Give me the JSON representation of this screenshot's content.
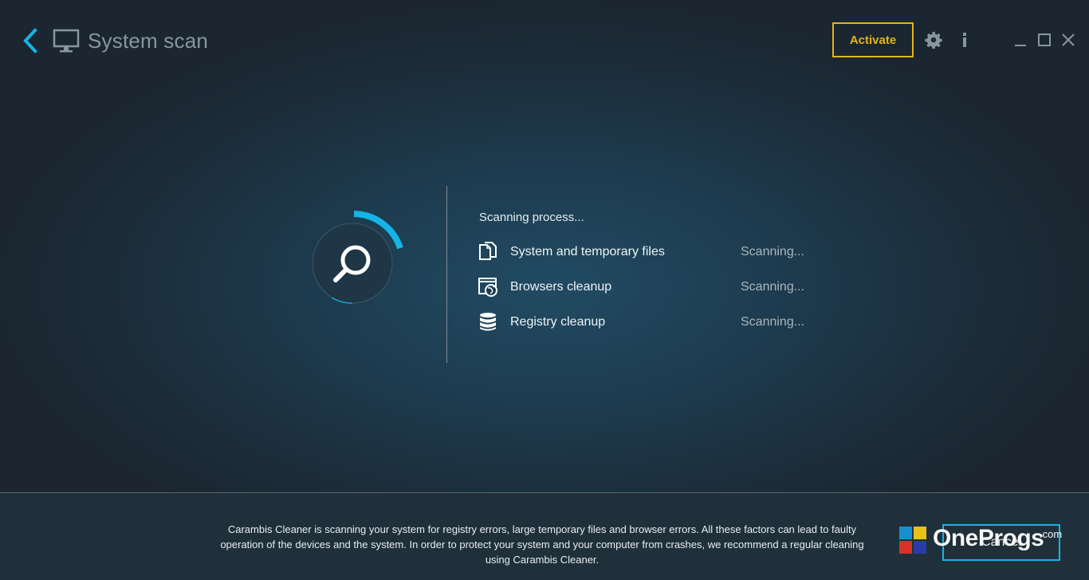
{
  "header": {
    "title": "System scan",
    "activate_label": "Activate",
    "accent_color": "#16b4e6",
    "activate_color": "#e2b41e"
  },
  "scan": {
    "heading": "Scanning process...",
    "items": [
      {
        "label": "System and temporary files",
        "status": "Scanning...",
        "icon": "files-icon"
      },
      {
        "label": "Browsers cleanup",
        "status": "Scanning...",
        "icon": "browser-globe-icon"
      },
      {
        "label": "Registry cleanup",
        "status": "Scanning...",
        "icon": "database-icon"
      }
    ]
  },
  "footer": {
    "description": "Carambis Cleaner is scanning your system for registry errors, large temporary files and browser errors. All these factors can lead to faulty operation of the devices and the system. In order to protect your system and your computer from crashes, we recommend a regular cleaning using Carambis Cleaner.",
    "cancel_label": "Cancel"
  },
  "watermark": {
    "text": "OneProgs",
    "suffix": ".com"
  }
}
